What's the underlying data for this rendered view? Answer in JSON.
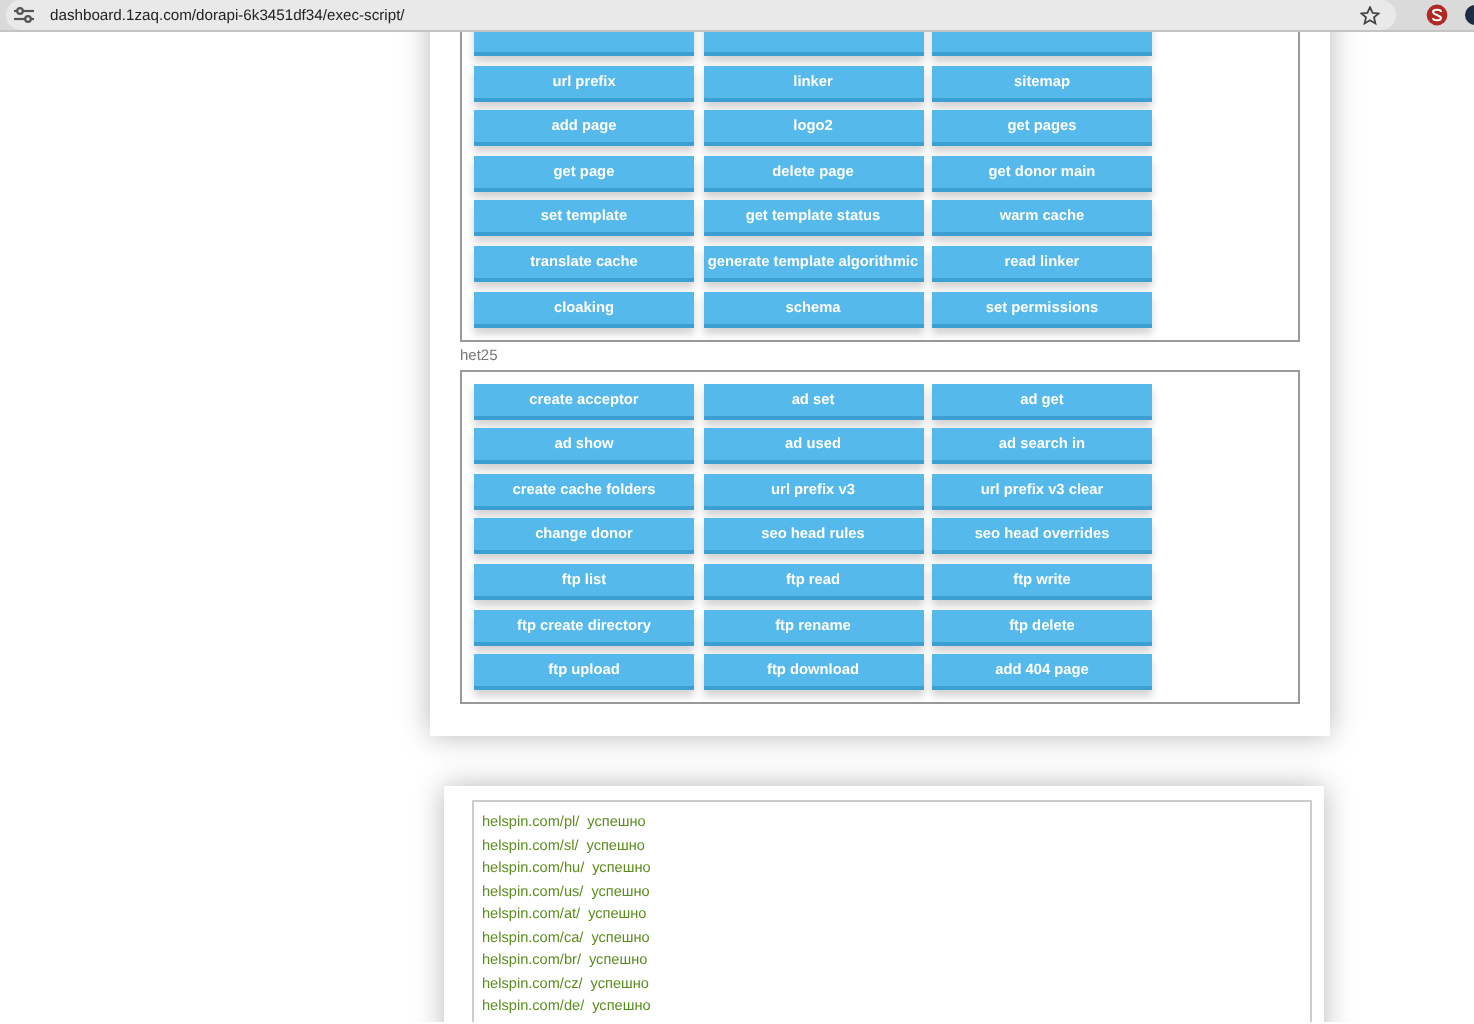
{
  "browser": {
    "url": "dashboard.1zaq.com/dorapi-6k3451df34/exec-script/"
  },
  "groups": [
    {
      "buttons": [
        {
          "kind": "cut"
        },
        {
          "kind": "cut"
        },
        {
          "kind": "cut"
        },
        {
          "kind": "button",
          "label": "url prefix"
        },
        {
          "kind": "button",
          "label": "linker"
        },
        {
          "kind": "button",
          "label": "sitemap"
        },
        {
          "kind": "button",
          "label": "add page"
        },
        {
          "kind": "button",
          "label": "logo2"
        },
        {
          "kind": "button",
          "label": "get pages"
        },
        {
          "kind": "button",
          "label": "get page"
        },
        {
          "kind": "button",
          "label": "delete page"
        },
        {
          "kind": "button",
          "label": "get donor main"
        },
        {
          "kind": "button",
          "label": "set template"
        },
        {
          "kind": "button",
          "label": "get template status"
        },
        {
          "kind": "button",
          "label": "warm cache"
        },
        {
          "kind": "button",
          "label": "translate cache"
        },
        {
          "kind": "button",
          "label": "generate template algorithmic"
        },
        {
          "kind": "button",
          "label": "read linker"
        },
        {
          "kind": "button",
          "label": "cloaking"
        },
        {
          "kind": "button",
          "label": "schema"
        },
        {
          "kind": "button",
          "label": "set permissions"
        }
      ]
    },
    {
      "label": "het25",
      "buttons": [
        {
          "kind": "button",
          "label": "create acceptor"
        },
        {
          "kind": "button",
          "label": "ad set"
        },
        {
          "kind": "button",
          "label": "ad get"
        },
        {
          "kind": "button",
          "label": "ad show"
        },
        {
          "kind": "button",
          "label": "ad used"
        },
        {
          "kind": "button",
          "label": "ad search in"
        },
        {
          "kind": "button",
          "label": "create cache folders"
        },
        {
          "kind": "button",
          "label": "url prefix v3"
        },
        {
          "kind": "button",
          "label": "url prefix v3 clear"
        },
        {
          "kind": "button",
          "label": "change donor"
        },
        {
          "kind": "button",
          "label": "seo head rules"
        },
        {
          "kind": "button",
          "label": "seo head overrides"
        },
        {
          "kind": "button",
          "label": "ftp list"
        },
        {
          "kind": "button",
          "label": "ftp read"
        },
        {
          "kind": "button",
          "label": "ftp write"
        },
        {
          "kind": "button",
          "label": "ftp create directory"
        },
        {
          "kind": "button",
          "label": "ftp rename"
        },
        {
          "kind": "button",
          "label": "ftp delete"
        },
        {
          "kind": "button",
          "label": "ftp upload"
        },
        {
          "kind": "button",
          "label": "ftp download"
        },
        {
          "kind": "button",
          "label": "add 404 page"
        }
      ]
    }
  ],
  "log": [
    {
      "url": "helspin.com/pl/",
      "status": "успешно"
    },
    {
      "url": "helspin.com/sl/",
      "status": "успешно"
    },
    {
      "url": "helspin.com/hu/",
      "status": "успешно"
    },
    {
      "url": "helspin.com/us/",
      "status": "успешно"
    },
    {
      "url": "helspin.com/at/",
      "status": "успешно"
    },
    {
      "url": "helspin.com/ca/",
      "status": "успешно"
    },
    {
      "url": "helspin.com/br/",
      "status": "успешно"
    },
    {
      "url": "helspin.com/cz/",
      "status": "успешно"
    },
    {
      "url": "helspin.com/de/",
      "status": "успешно"
    }
  ]
}
